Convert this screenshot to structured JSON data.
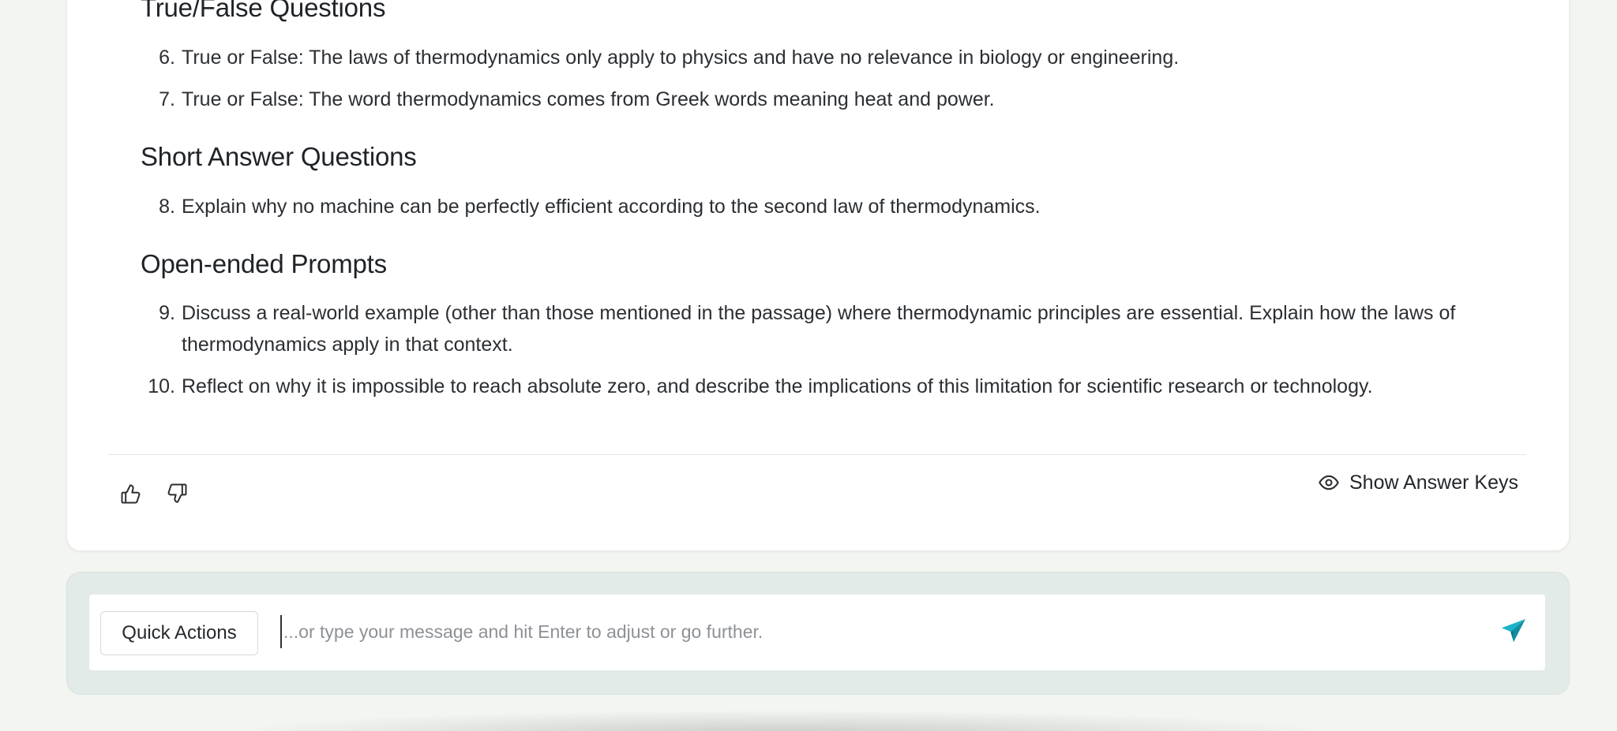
{
  "colors": {
    "background": "#f3f5f1",
    "card": "#ffffff",
    "composer": "#e3ebe8",
    "send_accent": "#14a0b4"
  },
  "content": {
    "sections": [
      {
        "heading": "True/False Questions",
        "questions": [
          {
            "num": "6.",
            "text": "True or False: The laws of thermodynamics only apply to physics and have no relevance in biology or engineering."
          },
          {
            "num": "7.",
            "text": "True or False: The word thermodynamics comes from Greek words meaning heat and power."
          }
        ]
      },
      {
        "heading": "Short Answer Questions",
        "questions": [
          {
            "num": "8.",
            "text": "Explain why no machine can be perfectly efficient according to the second law of thermodynamics."
          }
        ]
      },
      {
        "heading": "Open-ended Prompts",
        "questions": [
          {
            "num": "9.",
            "text": "Discuss a real-world example (other than those mentioned in the passage) where thermodynamic principles are essential. Explain how the laws of thermodynamics apply in that context."
          },
          {
            "num": "10.",
            "text": "Reflect on why it is impossible to reach absolute zero, and describe the implications of this limitation for scientific research or technology."
          }
        ]
      }
    ]
  },
  "feedback": {
    "thumbs_up_icon": "thumbs-up-icon",
    "thumbs_down_icon": "thumbs-down-icon"
  },
  "show_answer_keys": {
    "label": "Show Answer Keys",
    "icon": "eye-icon"
  },
  "composer": {
    "quick_actions_label": "Quick Actions",
    "placeholder": "...or type your message and hit Enter to adjust or go further.",
    "send_icon": "send-icon"
  }
}
